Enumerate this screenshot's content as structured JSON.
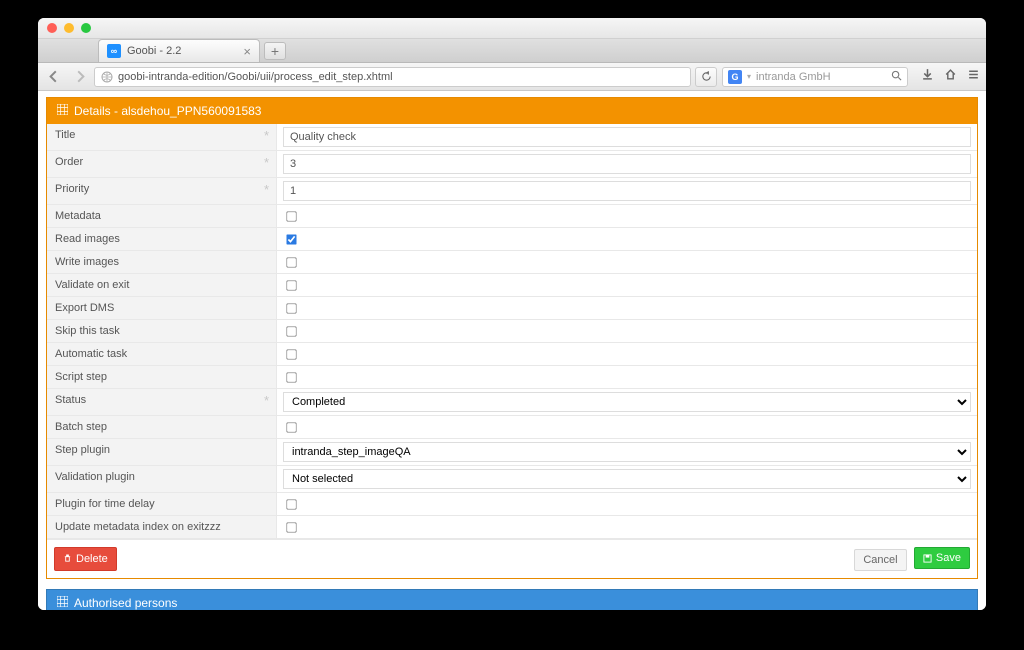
{
  "browser": {
    "tab_title": "Goobi - 2.2",
    "favicon_text": "∞",
    "url": "goobi-intranda-edition/Goobi/uii/process_edit_step.xhtml",
    "search_placeholder": "intranda GmbH"
  },
  "panel": {
    "title": "Details - alsdehou_PPN560091583"
  },
  "fields": {
    "title_label": "Title",
    "title_value": "Quality check",
    "order_label": "Order",
    "order_value": "3",
    "priority_label": "Priority",
    "priority_value": "1",
    "metadata_label": "Metadata",
    "read_images_label": "Read images",
    "write_images_label": "Write images",
    "validate_label": "Validate on exit",
    "export_label": "Export DMS",
    "skip_label": "Skip this task",
    "automatic_label": "Automatic task",
    "script_label": "Script step",
    "status_label": "Status",
    "status_value": "Completed",
    "batch_label": "Batch step",
    "step_plugin_label": "Step plugin",
    "step_plugin_value": "intranda_step_imageQA",
    "validation_plugin_label": "Validation plugin",
    "validation_plugin_value": "Not selected",
    "time_delay_label": "Plugin for time delay",
    "update_index_label": "Update metadata index on exitzzz"
  },
  "buttons": {
    "delete": "Delete",
    "cancel": "Cancel",
    "save": "Save"
  },
  "panel2": {
    "title": "Authorised persons"
  }
}
